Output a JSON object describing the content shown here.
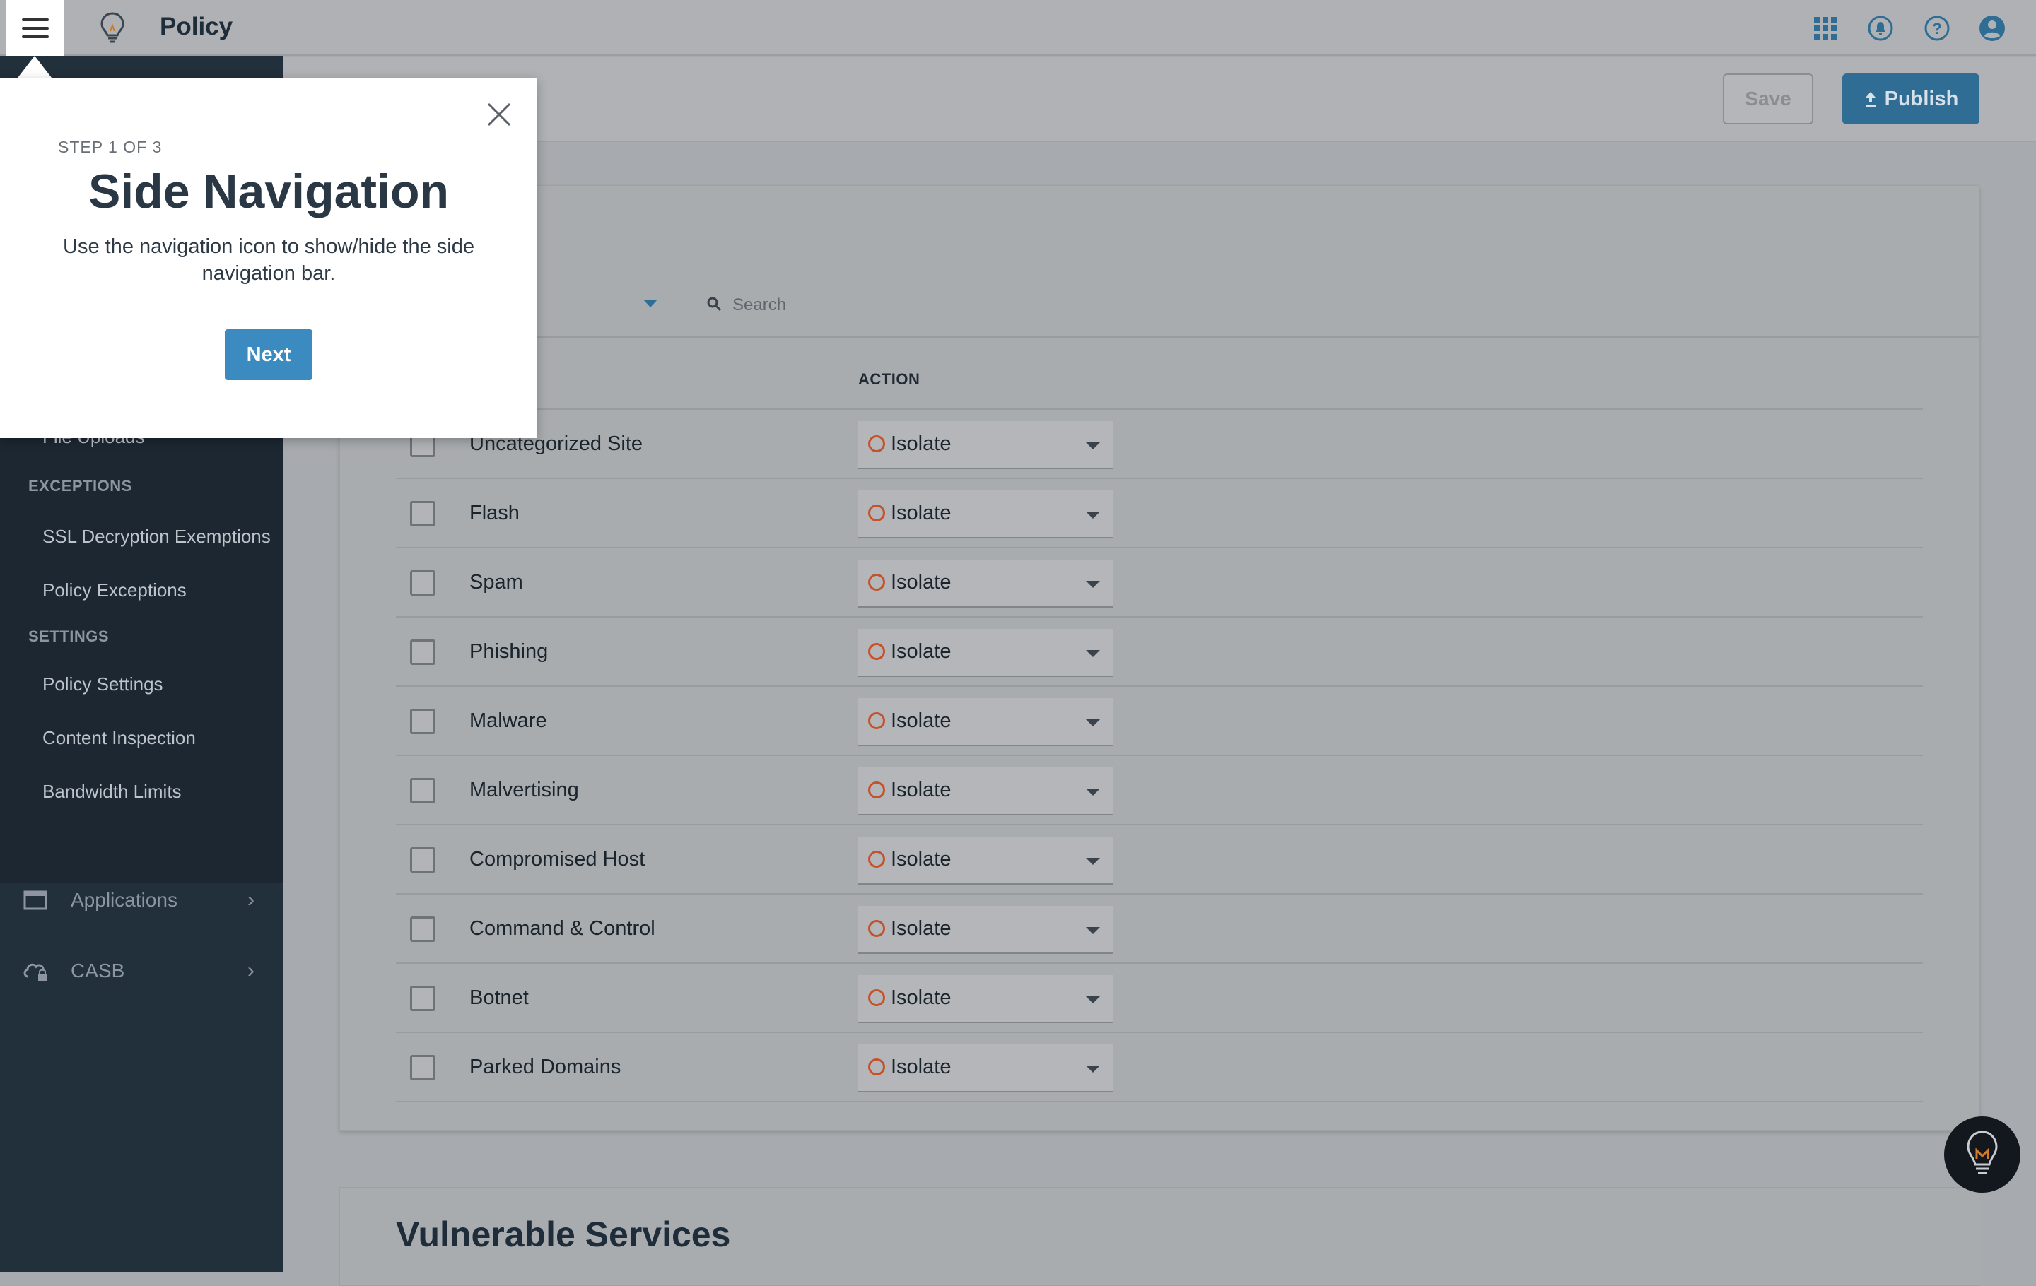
{
  "app": {
    "title": "Policy"
  },
  "colors": {
    "accent": "#3c8bc0",
    "publish": "#2f6d94",
    "sidebar": "#22303c",
    "isolate_ring": "#c4522a"
  },
  "header_icons": [
    "apps-grid-icon",
    "notifications-icon",
    "help-icon",
    "account-icon"
  ],
  "toolbar": {
    "save_label": "Save",
    "publish_label": "Publish"
  },
  "sidebar": {
    "partial_item": "File Uploads",
    "exceptions_header": "EXCEPTIONS",
    "exceptions": [
      "SSL Decryption Exemptions",
      "Policy Exceptions"
    ],
    "settings_header": "SETTINGS",
    "settings": [
      "Policy Settings",
      "Content Inspection",
      "Bandwidth Limits"
    ],
    "main": [
      {
        "label": "Applications",
        "icon": "window-icon"
      },
      {
        "label": "CASB",
        "icon": "cloud-lock-icon"
      }
    ]
  },
  "filter": {
    "search_placeholder": "Search"
  },
  "table": {
    "action_header": "ACTION",
    "rows": [
      {
        "name": "Uncategorized Site",
        "action": "Isolate"
      },
      {
        "name": "Flash",
        "action": "Isolate"
      },
      {
        "name": "Spam",
        "action": "Isolate"
      },
      {
        "name": "Phishing",
        "action": "Isolate"
      },
      {
        "name": "Malware",
        "action": "Isolate"
      },
      {
        "name": "Malvertising",
        "action": "Isolate"
      },
      {
        "name": "Compromised Host",
        "action": "Isolate"
      },
      {
        "name": "Command & Control",
        "action": "Isolate"
      },
      {
        "name": "Botnet",
        "action": "Isolate"
      },
      {
        "name": "Parked Domains",
        "action": "Isolate"
      }
    ]
  },
  "section2": {
    "title": "Vulnerable Services"
  },
  "tour": {
    "step": "STEP 1 OF 3",
    "title": "Side Navigation",
    "body": "Use the navigation icon to show/hide the side navigation bar.",
    "next_label": "Next"
  }
}
